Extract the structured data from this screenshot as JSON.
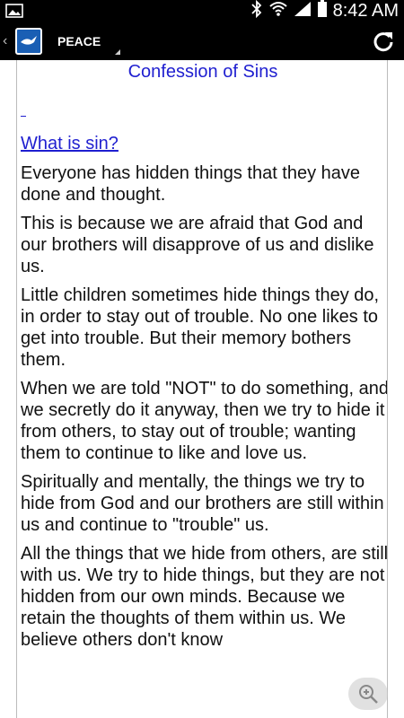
{
  "status_bar": {
    "time": "8:42 AM",
    "icons": [
      "image-notification-icon",
      "bluetooth-icon",
      "wifi-icon",
      "signal-icon",
      "battery-icon"
    ]
  },
  "action_bar": {
    "title": "PEACE",
    "logo_icon": "dove-logo-icon",
    "refresh_icon": "refresh-icon"
  },
  "content": {
    "title": "Confession of Sins",
    "section_link": "What is sin?",
    "paragraphs": [
      "Everyone has hidden things that they have done and thought.",
      "This is because we are afraid that God and our brothers will disapprove of us and dislike us.",
      "Little children sometimes hide things they do, in order to stay out of trouble. No one likes to get into trouble. But their memory bothers them.",
      "When we are told \"NOT\" to do something, and we secretly do it anyway, then we try to hide it from others, to stay out of trouble; wanting them to continue to like and love us.",
      "Spiritually and mentally, the things we try to hide from God and our brothers are still within us and continue to \"trouble\" us.",
      "All the things that we hide from others, are still with us. We try to hide things, but they are not hidden from our own minds. Because we retain the thoughts of them within us. We believe others don't know"
    ]
  },
  "colors": {
    "link": "#1f1fd0",
    "text": "#111111",
    "bar": "#000000"
  }
}
